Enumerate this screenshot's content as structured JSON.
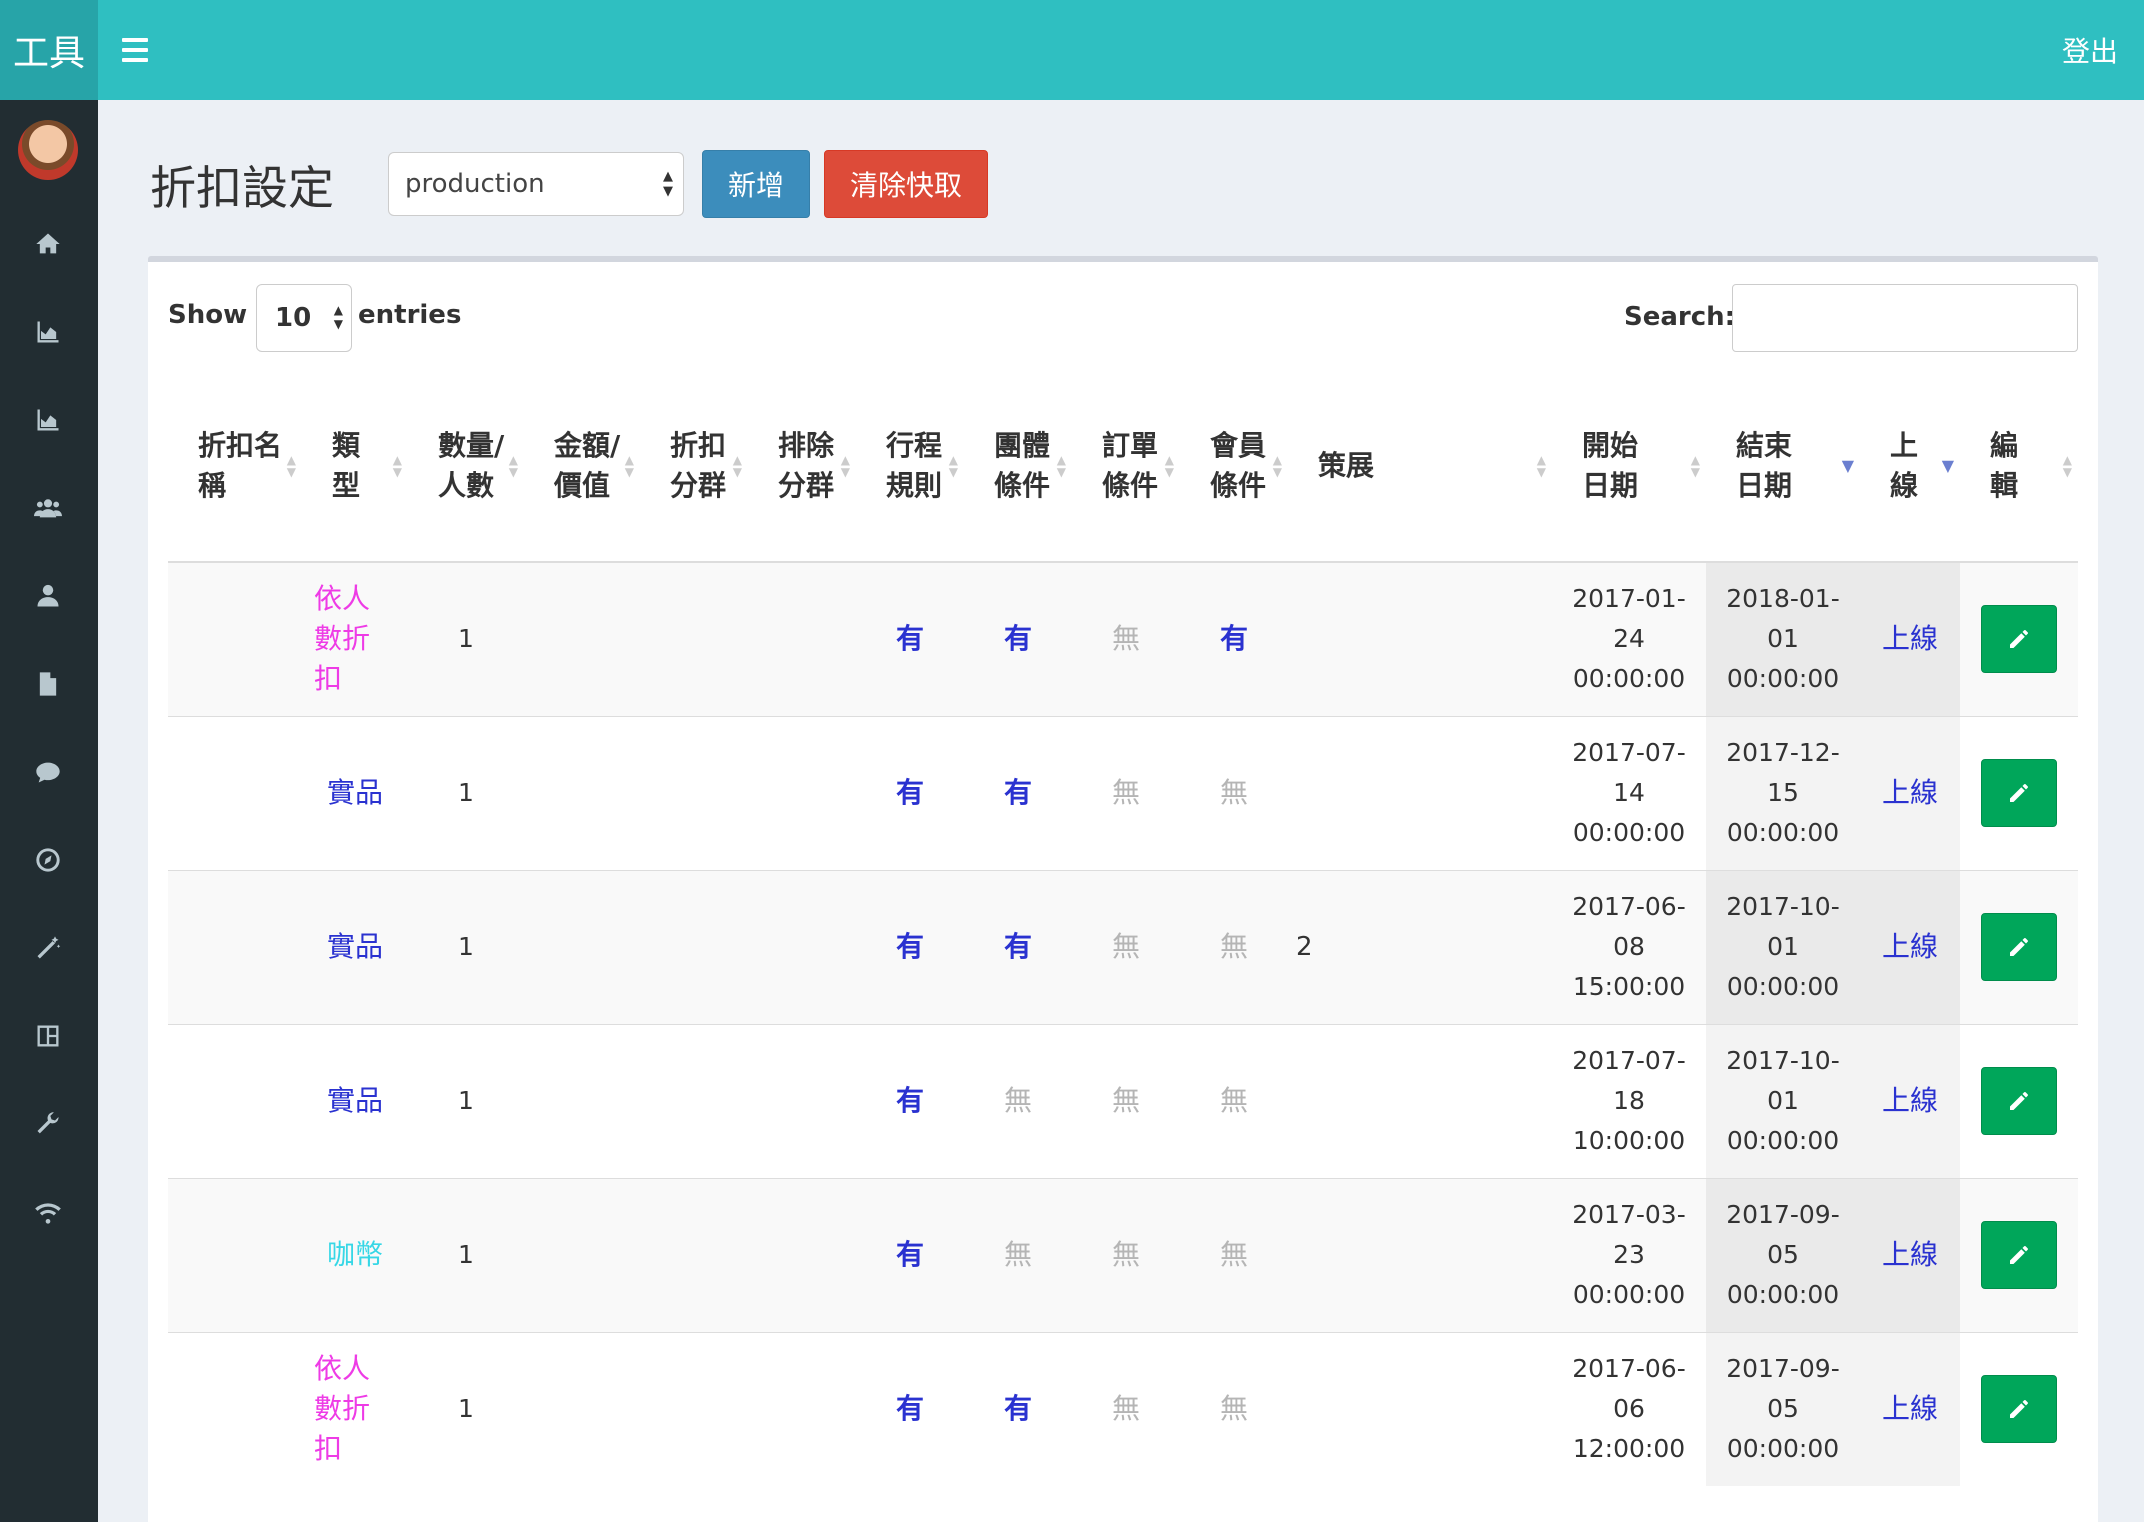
{
  "app": {
    "logo_text": "工具",
    "logout_label": "登出"
  },
  "sidebar": {
    "items": [
      {
        "icon": "home-icon"
      },
      {
        "icon": "area-chart-icon"
      },
      {
        "icon": "area-chart-icon"
      },
      {
        "icon": "users-icon"
      },
      {
        "icon": "user-icon"
      },
      {
        "icon": "file-icon"
      },
      {
        "icon": "comments-icon"
      },
      {
        "icon": "compass-icon"
      },
      {
        "icon": "magic-icon"
      },
      {
        "icon": "dashboard-icon"
      },
      {
        "icon": "wrench-icon"
      },
      {
        "icon": "wifi-icon"
      }
    ]
  },
  "header": {
    "title": "折扣設定",
    "env_value": "production",
    "add_label": "新增",
    "clear_cache_label": "清除快取"
  },
  "table_controls": {
    "show_label": "Show",
    "page_length": "10",
    "entries_label": "entries",
    "search_label": "Search:",
    "search_value": ""
  },
  "columns": [
    "折扣名稱",
    "類型",
    "數量/人數",
    "金額/價值",
    "折扣分群",
    "排除分群",
    "行程規則",
    "團體條件",
    "訂單條件",
    "會員條件",
    "策展",
    "開始日期",
    "結束日期",
    "上線",
    "編輯"
  ],
  "rows": [
    {
      "type": "依人數折扣",
      "type_color": "pink",
      "qty": "1",
      "trip": "有",
      "group": "有",
      "order": "無",
      "member": "有",
      "curation": "",
      "start": [
        "2017-01-",
        "24",
        "00:00:00"
      ],
      "end": [
        "2018-01-",
        "01",
        "00:00:00"
      ],
      "online": "上線"
    },
    {
      "type": "實品",
      "type_color": "blue",
      "qty": "1",
      "trip": "有",
      "group": "有",
      "order": "無",
      "member": "無",
      "curation": "",
      "start": [
        "2017-07-",
        "14",
        "00:00:00"
      ],
      "end": [
        "2017-12-",
        "15",
        "00:00:00"
      ],
      "online": "上線"
    },
    {
      "type": "實品",
      "type_color": "blue",
      "qty": "1",
      "trip": "有",
      "group": "有",
      "order": "無",
      "member": "無",
      "curation": "2",
      "start": [
        "2017-06-",
        "08",
        "15:00:00"
      ],
      "end": [
        "2017-10-",
        "01",
        "00:00:00"
      ],
      "online": "上線"
    },
    {
      "type": "實品",
      "type_color": "blue",
      "qty": "1",
      "trip": "有",
      "group": "無",
      "order": "無",
      "member": "無",
      "curation": "",
      "start": [
        "2017-07-",
        "18",
        "10:00:00"
      ],
      "end": [
        "2017-10-",
        "01",
        "00:00:00"
      ],
      "online": "上線"
    },
    {
      "type": "咖幣",
      "type_color": "cyan",
      "qty": "1",
      "trip": "有",
      "group": "無",
      "order": "無",
      "member": "無",
      "curation": "",
      "start": [
        "2017-03-",
        "23",
        "00:00:00"
      ],
      "end": [
        "2017-09-",
        "05",
        "00:00:00"
      ],
      "online": "上線"
    },
    {
      "type": "依人數折扣",
      "type_color": "pink",
      "qty": "1",
      "trip": "有",
      "group": "有",
      "order": "無",
      "member": "無",
      "curation": "",
      "start": [
        "2017-06-",
        "06",
        "12:00:00"
      ],
      "end": [
        "2017-09-",
        "05",
        "00:00:00"
      ],
      "online": "上線"
    }
  ],
  "colors": {
    "topbar": "#2fbfc1",
    "sidebar": "#222d32",
    "add_btn": "#3c8dbc",
    "clear_btn": "#dd4b39",
    "edit_btn": "#00a65a",
    "link": "#2a32d0"
  }
}
